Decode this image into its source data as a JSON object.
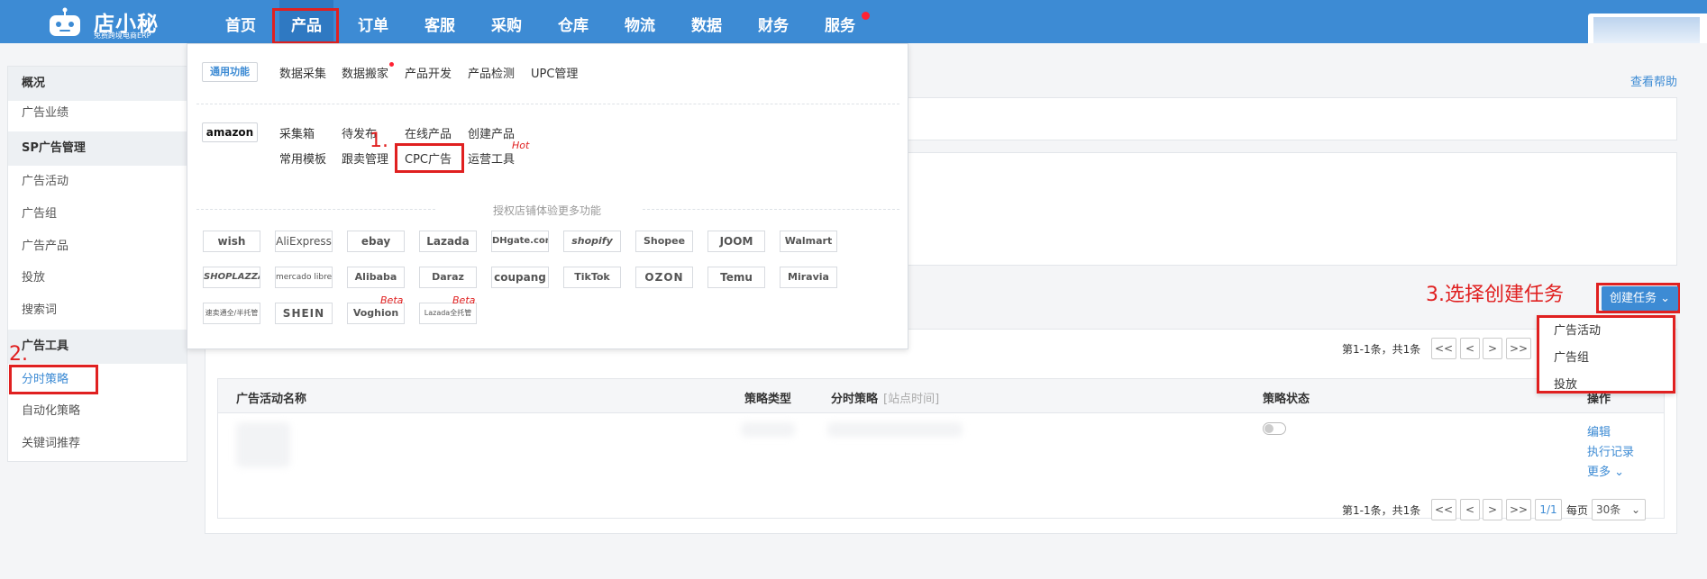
{
  "brand": {
    "name": "店小秘",
    "slogan": "免费跨境电商ERP"
  },
  "nav": {
    "items": [
      "首页",
      "产品",
      "订单",
      "客服",
      "采购",
      "仓库",
      "物流",
      "数据",
      "财务",
      "服务"
    ]
  },
  "sidebar": {
    "overview": "概况",
    "ad_performance": "广告业绩",
    "sp_section": "SP广告管理",
    "sp_items": [
      "广告活动",
      "广告组",
      "广告产品",
      "投放",
      "搜索词"
    ],
    "tools_section": "广告工具",
    "tool_items": [
      "分时策略",
      "自动化策略",
      "关键词推荐"
    ]
  },
  "annotations": {
    "step1": "1.",
    "step2": "2.",
    "step3": "3.选择创建任务"
  },
  "help_link": "查看帮助",
  "mega_menu": {
    "general_badge": "通用功能",
    "general_items": [
      "数据采集",
      "数据搬家",
      "产品开发",
      "产品检测",
      "UPC管理"
    ],
    "amazon_badge": "amazon",
    "amazon_row1": [
      "采集箱",
      "待发布",
      "在线产品",
      "创建产品"
    ],
    "amazon_row2": [
      "常用模板",
      "跟卖管理",
      "CPC广告",
      "运营工具"
    ],
    "hot_tag": "Hot",
    "authorize_text": "授权店铺体验更多功能",
    "platforms_row1": [
      "wish",
      "AliExpress",
      "ebay",
      "Lazada",
      "DHgate.com",
      "shopify",
      "Shopee",
      "JOOM",
      "Walmart"
    ],
    "platforms_row2": [
      "SHOPLAZZA",
      "mercado libre",
      "Alibaba",
      "Daraz",
      "coupang",
      "TikTok",
      "OZON",
      "Temu",
      "Miravia"
    ],
    "platforms_row3": [
      "速卖通全/半托管",
      "SHEIN",
      "Voghion",
      "Lazada全托管"
    ],
    "beta_tag": "Beta"
  },
  "create_task": {
    "label": "创建任务",
    "options": [
      "广告活动",
      "广告组",
      "投放"
    ]
  },
  "table": {
    "headers": [
      "广告活动名称",
      "策略类型",
      "分时策略",
      "[站点时间]",
      "策略状态",
      "操作"
    ],
    "row_actions": [
      "编辑",
      "执行记录",
      "更多"
    ]
  },
  "pagination": {
    "summary": "第1-1条，共1条",
    "first": "<<",
    "prev": "<",
    "next": ">",
    "last": ">>",
    "page_info": "1/1",
    "per_page_label": "每页",
    "per_page_value": "30条"
  }
}
